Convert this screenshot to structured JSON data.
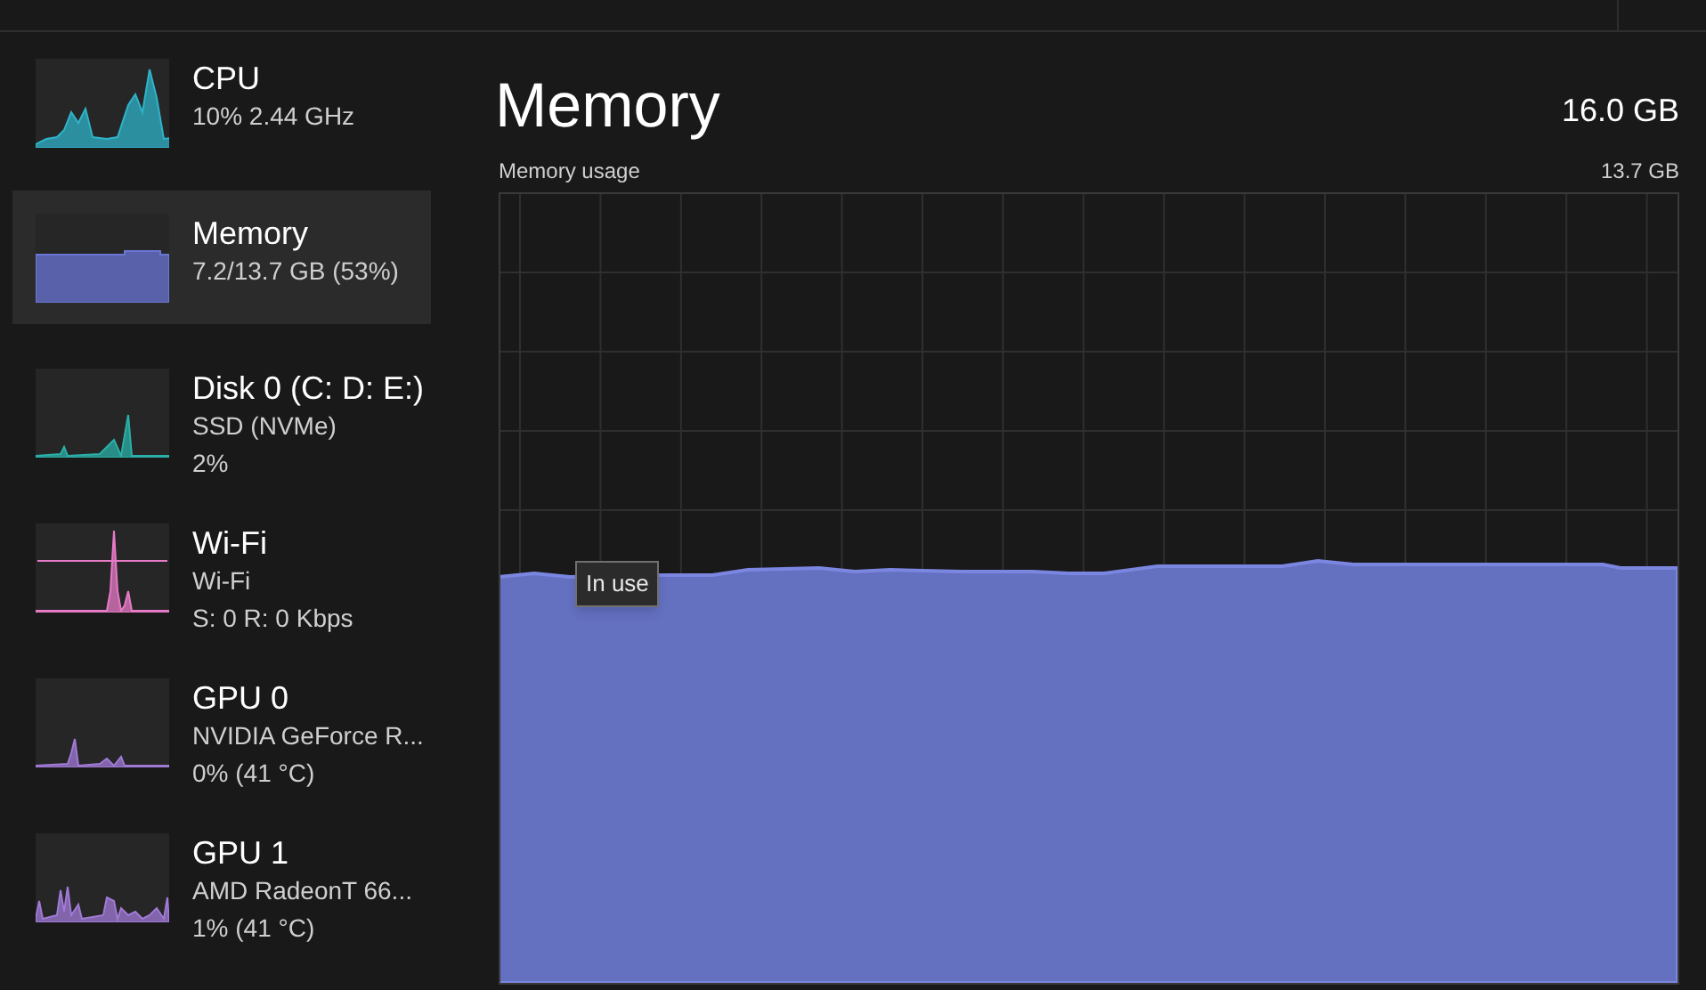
{
  "sidebar": {
    "items": [
      {
        "title": "CPU",
        "lines": [
          "10%  2.44 GHz"
        ],
        "color": "#2fb3c9",
        "selected": false
      },
      {
        "title": "Memory",
        "lines": [
          "7.2/13.7 GB (53%)"
        ],
        "color": "#6a76d6",
        "selected": true
      },
      {
        "title": "Disk 0 (C: D: E:)",
        "lines": [
          "SSD (NVMe)",
          "2%"
        ],
        "color": "#2ab0a8",
        "selected": false
      },
      {
        "title": "Wi-Fi",
        "lines": [
          "Wi-Fi",
          "S: 0 R: 0 Kbps"
        ],
        "color": "#e67ac6",
        "selected": false
      },
      {
        "title": "GPU 0",
        "lines": [
          "NVIDIA GeForce R...",
          "0%  (41 °C)"
        ],
        "color": "#a07ad6",
        "selected": false
      },
      {
        "title": "GPU 1",
        "lines": [
          "AMD RadeonT 66...",
          "1%  (41 °C)"
        ],
        "color": "#a07ad6",
        "selected": false
      }
    ]
  },
  "main": {
    "title": "Memory",
    "total": "16.0 GB",
    "graph_label": "Memory usage",
    "graph_max": "13.7 GB",
    "tooltip": "In use"
  }
}
